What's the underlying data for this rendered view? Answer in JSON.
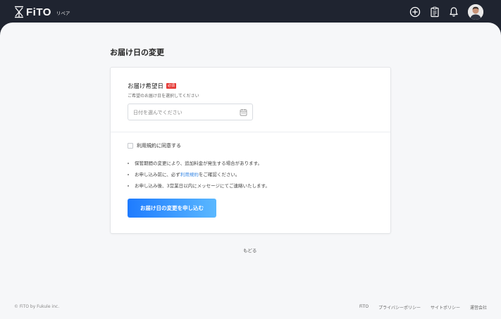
{
  "header": {
    "logo_text": "FiTO",
    "logo_sub": "リペア",
    "icons": [
      "plus-circle-icon",
      "clipboard-icon",
      "bell-icon"
    ],
    "avatar": "user-avatar"
  },
  "page": {
    "title": "お届け日の変更"
  },
  "form": {
    "field_label": "お届け希望日",
    "required_badge": "必須",
    "field_help": "ご希望のお届け日を選択してください",
    "date_placeholder": "日付を選んでください",
    "date_value": "",
    "agree_label": "利用規約に同意する",
    "agree_checked": false,
    "notes": [
      {
        "text": "保管期間の変更により、追加料金が発生する場合があります。"
      },
      {
        "pre": "お申し込み前に、必ず",
        "link": "利用規約",
        "post": "をご確認ください。"
      },
      {
        "text": "お申し込み後、3営業日以内にメッセージにてご連絡いたします。"
      }
    ],
    "submit_label": "お届け日の変更を申し込む"
  },
  "back_label": "もどる",
  "footer": {
    "copyright": "© FiTO by Fukule inc.",
    "links": [
      "FiTO",
      "プライバシーポリシー",
      "サイトポリシー",
      "運営会社"
    ]
  },
  "colors": {
    "header_bg": "#1f2430",
    "page_bg": "#f6f7f9",
    "button_start": "#1e7bff",
    "button_end": "#5ab8ff",
    "required": "#e53935",
    "link": "#3d8be6"
  }
}
